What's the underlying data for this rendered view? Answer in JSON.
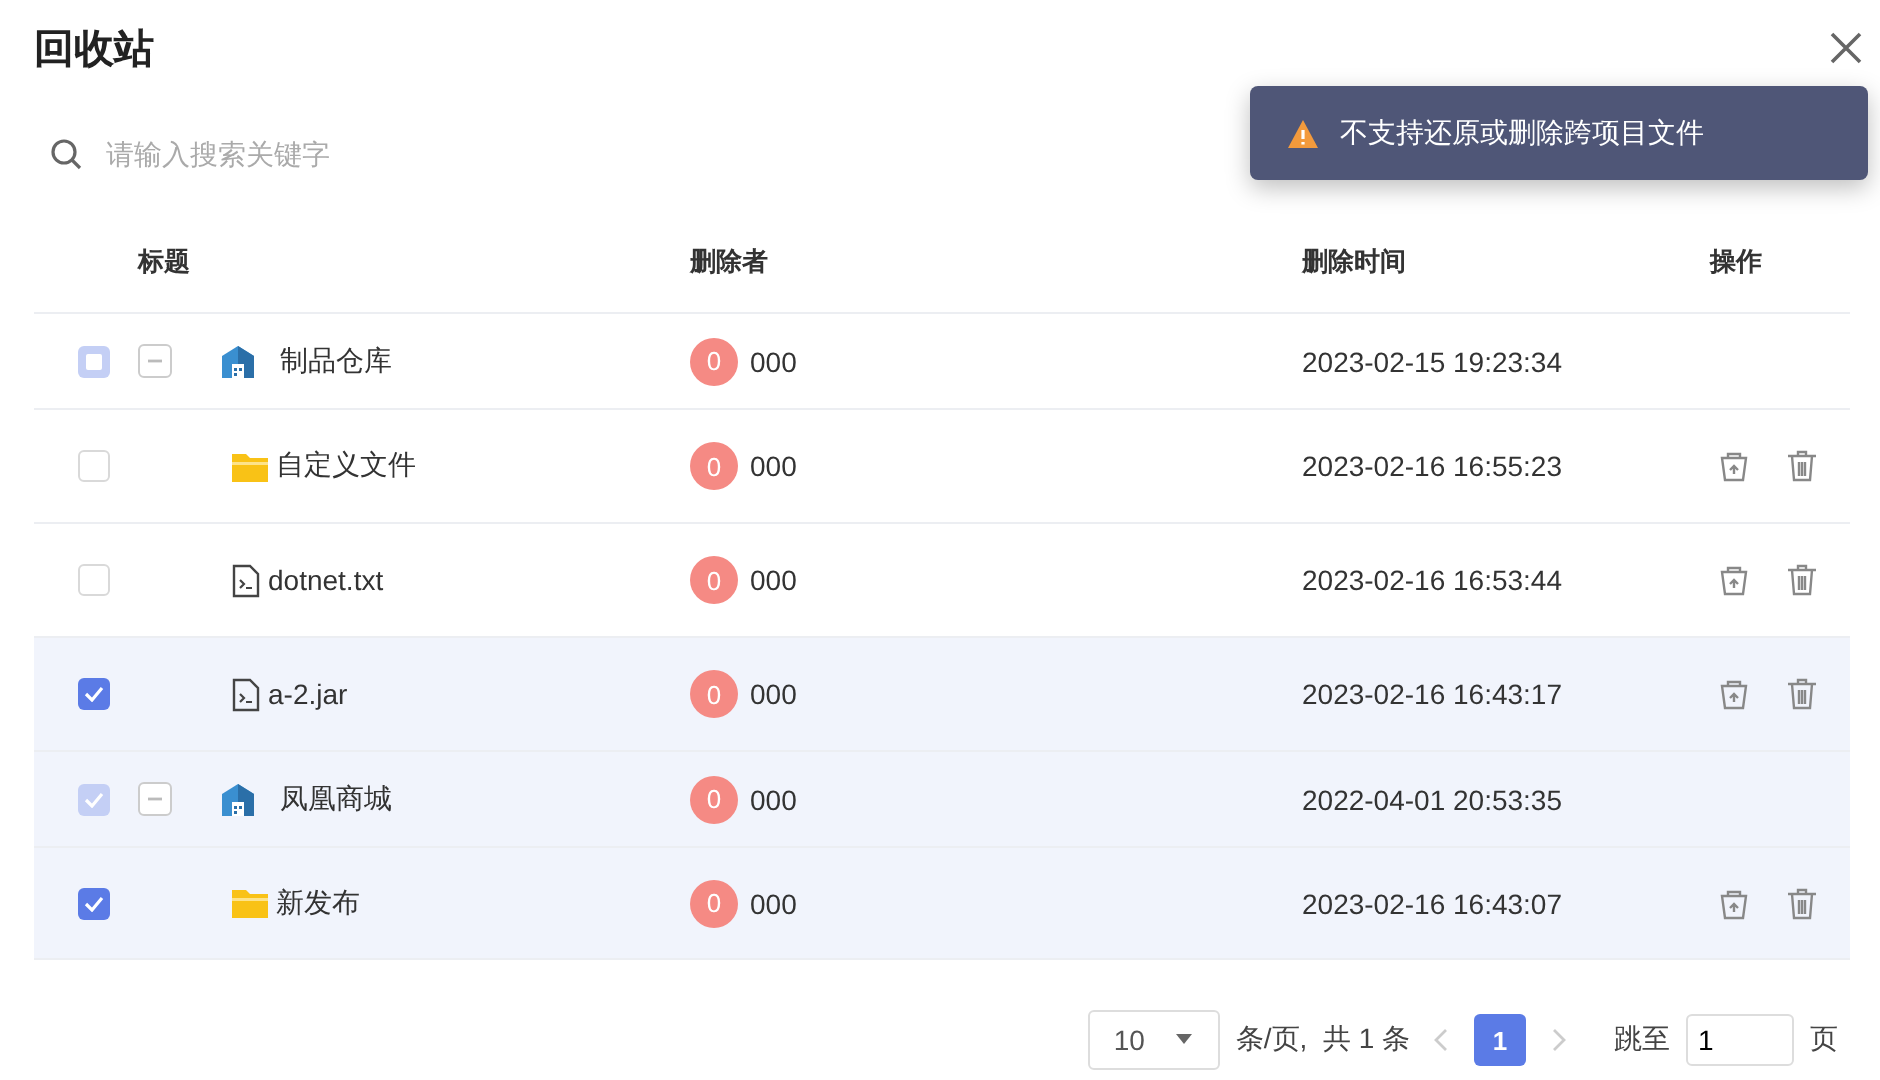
{
  "dialog": {
    "title": "回收站"
  },
  "search": {
    "placeholder": "请输入搜索关键字"
  },
  "toast": {
    "kind": "warning",
    "message": "不支持还原或删除跨项目文件"
  },
  "table": {
    "columns": [
      "标题",
      "删除者",
      "删除时间",
      "操作"
    ],
    "rows": [
      {
        "kind": "project",
        "title": "制品仓库",
        "checked": false,
        "indeterminate": true,
        "disabled": true,
        "selected": false,
        "expanded": true,
        "avatar": "0",
        "deleter": "000",
        "time": "2023-02-15 19:23:34"
      },
      {
        "kind": "folder",
        "title": "自定义文件",
        "checked": false,
        "disabled": false,
        "selected": false,
        "avatar": "0",
        "deleter": "000",
        "time": "2023-02-16 16:55:23"
      },
      {
        "kind": "file",
        "title": "dotnet.txt",
        "checked": false,
        "disabled": false,
        "selected": false,
        "avatar": "0",
        "deleter": "000",
        "time": "2023-02-16 16:53:44"
      },
      {
        "kind": "file",
        "title": "a-2.jar",
        "checked": true,
        "disabled": false,
        "selected": true,
        "avatar": "0",
        "deleter": "000",
        "time": "2023-02-16 16:43:17"
      },
      {
        "kind": "project",
        "title": "凤凰商城",
        "checked": true,
        "disabled": true,
        "selected": true,
        "expanded": true,
        "avatar": "0",
        "deleter": "000",
        "time": "2022-04-01 20:53:35"
      },
      {
        "kind": "folder",
        "title": "新发布",
        "checked": true,
        "disabled": false,
        "selected": true,
        "avatar": "0",
        "deleter": "000",
        "time": "2023-02-16 16:43:07"
      }
    ]
  },
  "pagination": {
    "page_size": "10",
    "summary": "条/页,  共 1 条",
    "pages": [
      {
        "label": "1",
        "selected": true
      }
    ],
    "jump_label": "跳至",
    "jump_value": "1",
    "page_unit": "页"
  }
}
